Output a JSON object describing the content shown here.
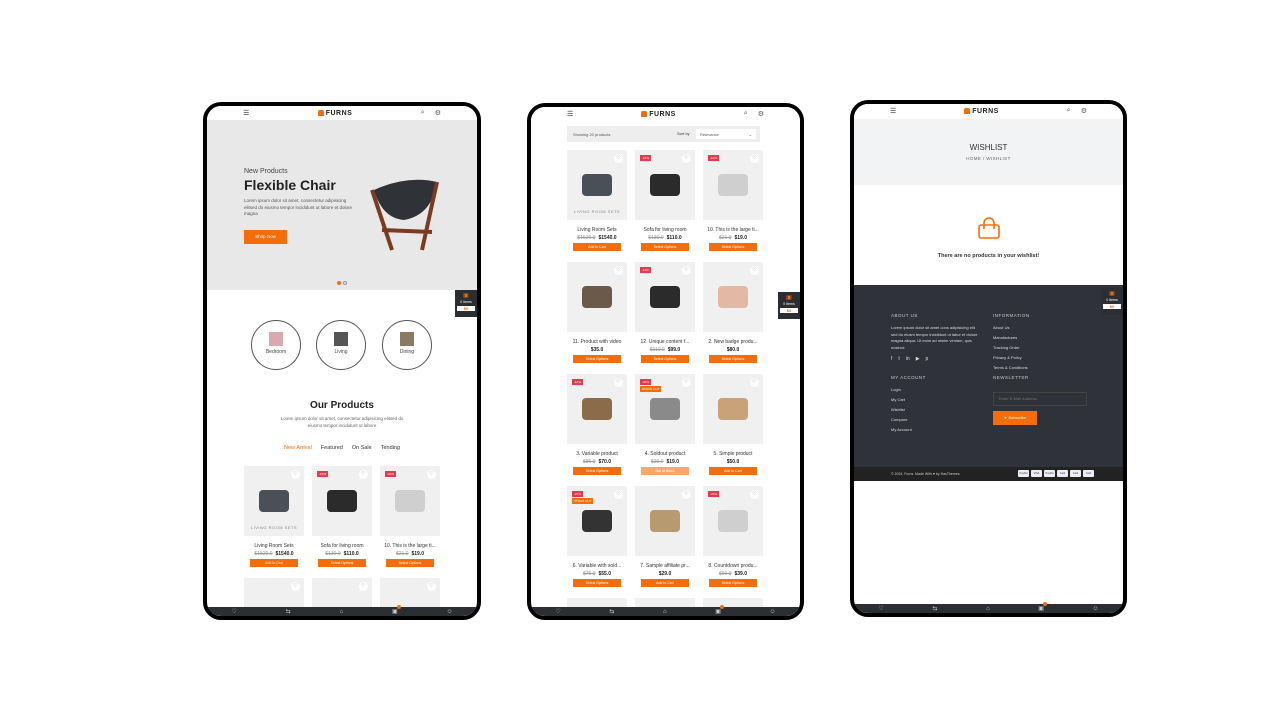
{
  "brand": "FURNS",
  "colors": {
    "accent": "#f36d0d",
    "dark": "#2b2e33",
    "badge": "#e53950"
  },
  "home": {
    "hero": {
      "subtitle": "New Products",
      "title": "Flexible Chair",
      "desc": "Lorem ipsum dolor sit amet, consectetur adipisicing elitsed do eiusmo tempor incididunt ut labore et dolore magna",
      "button": "Shop Now"
    },
    "categories": [
      "Bedroom",
      "Living",
      "Dining"
    ],
    "section_title": "Our Products",
    "section_desc": "Lorem ipsum dolor sit amet, consectetur adipisicing elitsed do eiusmo tempor incididunt ut labore",
    "tabs": [
      "New Arrival",
      "Featured",
      "On Sale",
      "Tending"
    ],
    "products": [
      {
        "name": "Living Room Sets",
        "old": "$1520.0",
        "price": "$1540.0",
        "button": "Add to Cart",
        "caption": "LIVING ROOM SETS",
        "badge": ""
      },
      {
        "name": "Sofa for living room",
        "old": "$130.0",
        "price": "$110.0",
        "button": "Select Options",
        "badge": "-15%"
      },
      {
        "name": "10. This is the large ti...",
        "old": "$21.0",
        "price": "$19.0",
        "button": "Select Options",
        "badge": "-10%"
      }
    ]
  },
  "cart_widget": {
    "items": "0 Items",
    "amount": "$0"
  },
  "shop": {
    "showing": "Showing 20 products",
    "sort_label": "Sort by",
    "sort_value": "Relevance",
    "products": [
      {
        "name": "Living Room Sets",
        "old": "$1520.0",
        "price": "$1540.0",
        "button": "Add to Cart",
        "caption": "LIVING ROOM SETS",
        "badge": ""
      },
      {
        "name": "Sofa for living room",
        "old": "$130.0",
        "price": "$110.0",
        "button": "Select Options",
        "badge": "-15%"
      },
      {
        "name": "10. This is the large ti...",
        "old": "$21.0",
        "price": "$19.0",
        "button": "Select Options",
        "badge": "-10%"
      },
      {
        "name": "11. Product with video",
        "old": "",
        "price": "$35.0",
        "button": "Select Options",
        "badge": ""
      },
      {
        "name": "12. Unique content f...",
        "old": "$110.0",
        "price": "$99.0",
        "button": "Select Options",
        "badge": "-11%"
      },
      {
        "name": "2. New badge produ...",
        "old": "",
        "price": "$80.0",
        "button": "Select Options",
        "badge": ""
      },
      {
        "name": "3. Variable product",
        "old": "$85.0",
        "price": "$70.0",
        "button": "Select Options",
        "badge": "-18%"
      },
      {
        "name": "4. Soldout product",
        "old": "$29.0",
        "price": "$19.0",
        "button": "Out of Stock",
        "badge": "-34%",
        "stock": "STOCK OUT"
      },
      {
        "name": "5. Simple product",
        "old": "",
        "price": "$50.0",
        "button": "Add to Cart",
        "badge": ""
      },
      {
        "name": "6. Variable with sold...",
        "old": "$75.0",
        "price": "$55.0",
        "button": "Select Options",
        "badge": "-27%",
        "stock": "STOCK OUT"
      },
      {
        "name": "7. Sample affiliate pr...",
        "old": "",
        "price": "$29.0",
        "button": "Add to Cart",
        "badge": ""
      },
      {
        "name": "8. Countdown produ...",
        "old": "$60.0",
        "price": "$39.0",
        "button": "Select Options",
        "badge": "-35%"
      }
    ]
  },
  "wishlist": {
    "title": "WISHLIST",
    "breadcrumb": "HOME / WISHLIST",
    "empty": "There are no products in your wishlist!",
    "footer": {
      "about_title": "ABOUT US",
      "about_text": "Lorem ipsum dolor sit amet cons adipisicing elit sed do eiusm tempor incididunt ut labor et dolore magna aliqua. Ut enim ad minim veniam, quis nostrud.",
      "info_title": "INFORMATION",
      "info_links": [
        "About Us",
        "Manufactures",
        "Tracking Order",
        "Privacy & Policy",
        "Terms & Conditions"
      ],
      "account_title": "MY ACCOUNT",
      "account_links": [
        "Login",
        "My Cart",
        "Wishlist",
        "Compare",
        "My Account"
      ],
      "news_title": "NEWSLETTER",
      "email_placeholder": "Enter E-Mail Address",
      "subscribe": "Subscribe",
      "copyright": "© 2024, Furns. Made With ♥ by HasThemes.",
      "payments": [
        "PayPal",
        "VISA",
        "PayPal",
        "Card",
        "Card",
        "Card"
      ]
    }
  }
}
